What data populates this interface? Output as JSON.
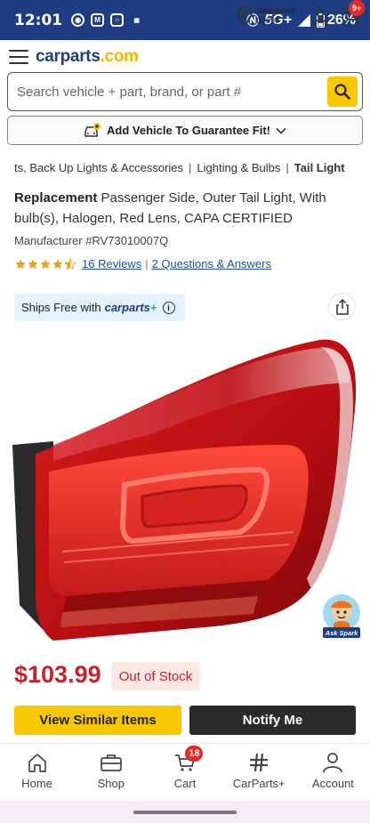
{
  "status_bar": {
    "time": "12:01",
    "network": "5G+",
    "battery": "26%"
  },
  "header": {
    "logo_main": "carparts",
    "logo_dot": ".com",
    "location_city": "Jacksonvill...",
    "location_zip": "32099",
    "cart_count": "9+"
  },
  "search": {
    "placeholder": "Search vehicle + part, brand, or part #"
  },
  "add_vehicle": {
    "label": "Add Vehicle To Guarantee Fit!"
  },
  "breadcrumb": {
    "items": [
      "ts, Back Up Lights & Accessories",
      "Lighting & Bulbs",
      "Tail Light"
    ]
  },
  "product": {
    "title_bold": "Replacement",
    "title_rest": " Passenger Side, Outer Tail Light, With bulb(s), Halogen, Red Lens, CAPA CERTIFIED",
    "manufacturer": "Manufacturer #RV73010007Q",
    "rating": 4.5,
    "reviews_link": "16 Reviews",
    "qa_link": "2 Questions & Answers",
    "ships_free_prefix": "Ships Free with",
    "ships_free_brand": "carparts",
    "ships_free_plus": "+",
    "price": "$103.99",
    "stock_status": "Out of Stock",
    "ask_spark": "Ask Spark"
  },
  "actions": {
    "similar": "View Similar Items",
    "notify": "Notify Me"
  },
  "bottom_nav": {
    "items": [
      "Home",
      "Shop",
      "Cart",
      "CarParts+",
      "Account"
    ],
    "cart_badge": "18"
  },
  "colors": {
    "brand_blue": "#1f3d82",
    "accent_yellow": "#f7c800",
    "price_red": "#c8232c"
  }
}
